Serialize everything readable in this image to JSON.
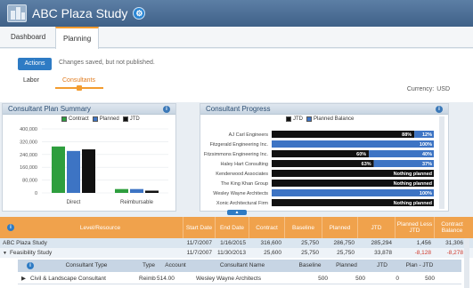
{
  "app": {
    "title": "ABC Plaza Study",
    "info_icon": "wrench-icon"
  },
  "tabs": [
    {
      "label": "Dashboard"
    },
    {
      "label": "Planning",
      "active": true
    }
  ],
  "toolbar": {
    "actions_label": "Actions",
    "status_text": "Changes saved, but not published."
  },
  "subtabs": [
    {
      "label": "Labor"
    },
    {
      "label": "Consultants",
      "active": true
    }
  ],
  "currency": {
    "label": "Currency:",
    "value": "USD"
  },
  "summary": {
    "title": "Consultant Plan Summary",
    "legend": [
      {
        "label": "Contract",
        "color": "#2e9e3e"
      },
      {
        "label": "Planned",
        "color": "#3d74c4"
      },
      {
        "label": "JTD",
        "color": "#111111"
      }
    ]
  },
  "progress": {
    "title": "Consultant Progress",
    "legend": [
      {
        "label": "JTD",
        "color": "#111111"
      },
      {
        "label": "Planned Balance",
        "color": "#3d74c4"
      }
    ]
  },
  "chart_data": [
    {
      "type": "bar",
      "categories": [
        "Direct",
        "Reimbursable"
      ],
      "series": [
        {
          "name": "Contract",
          "values": [
            290000,
            24000
          ]
        },
        {
          "name": "Planned",
          "values": [
            262000,
            24000
          ]
        },
        {
          "name": "JTD",
          "values": [
            272000,
            14000
          ]
        }
      ],
      "ylim": [
        0,
        400000
      ],
      "yticks": [
        "400,000",
        "320,000",
        "240,000",
        "160,000",
        "80,000",
        "0"
      ],
      "colors": [
        "#2e9e3e",
        "#3d74c4",
        "#111111"
      ]
    },
    {
      "type": "bar",
      "orientation": "horizontal",
      "categories": [
        "AJ Carl Engineers",
        "Fitzgerald Engineering Inc.",
        "Fitzsimmons Engineering Inc.",
        "Haley Hart Consulting",
        "Kenderwood Associates",
        "The King Khan Group",
        "Wesley Wayne Architects",
        "Xonic Architectural Firm"
      ],
      "series": [
        {
          "name": "JTD",
          "values": [
            88,
            0,
            60,
            63,
            0,
            0,
            0,
            0
          ]
        },
        {
          "name": "Planned Balance",
          "values": [
            12,
            100,
            40,
            37,
            0,
            0,
            100,
            0
          ]
        }
      ],
      "labels": [
        [
          "88%",
          "12%"
        ],
        [
          "",
          "100%"
        ],
        [
          "60%",
          "40%"
        ],
        [
          "63%",
          "37%"
        ],
        [
          "Nothing planned",
          ""
        ],
        [
          "Nothing planned",
          ""
        ],
        [
          "",
          "100%"
        ],
        [
          "Nothing planned",
          ""
        ]
      ]
    }
  ],
  "grid": {
    "columns": [
      "Level/Resource",
      "Start Date",
      "End Date",
      "Contract",
      "Baseline",
      "Planned",
      "JTD",
      "Planned Less JTD",
      "Contract Balance"
    ],
    "rows": [
      {
        "name": "ABC Plaza Study",
        "start": "11/7/2007",
        "end": "1/16/2015",
        "contract": "316,600",
        "baseline": "25,750",
        "planned": "286,750",
        "jtd": "285,294",
        "pl_jtd": "1,456",
        "balance": "31,306"
      },
      {
        "name": "Feasibility Study",
        "start": "11/7/2007",
        "end": "11/30/2013",
        "contract": "25,600",
        "baseline": "25,750",
        "planned": "25,750",
        "jtd": "33,878",
        "pl_jtd": "-8,128",
        "balance": "-8,278"
      }
    ],
    "sub_columns": [
      "Consultant Type",
      "Type",
      "Account",
      "Consultant Name",
      "Baseline",
      "Planned",
      "JTD",
      "Plan - JTD"
    ],
    "sub_rows": [
      {
        "type_name": "Civil & Landscape Consultant",
        "type": "Reimb",
        "account": "514.00",
        "consultant": "Wesley Wayne Architects",
        "baseline": "500",
        "planned": "500",
        "jtd": "0",
        "plan_jtd": "500"
      }
    ]
  }
}
